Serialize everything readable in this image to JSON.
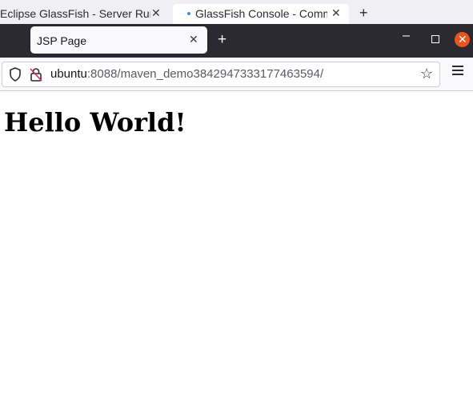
{
  "outer_tabs": [
    {
      "label": "Eclipse GlassFish - Server Running"
    },
    {
      "label": "GlassFish Console - Common Tasks"
    }
  ],
  "tab": {
    "title": "JSP Page"
  },
  "address": {
    "host": "ubuntu",
    "path": ":8088/maven_demo3842947333177463594/"
  },
  "page": {
    "heading": "Hello World!"
  },
  "colors": {
    "titlebar": "#2b2a33",
    "close_button": "#e95420",
    "tab_dot": "#3b8fdd"
  }
}
